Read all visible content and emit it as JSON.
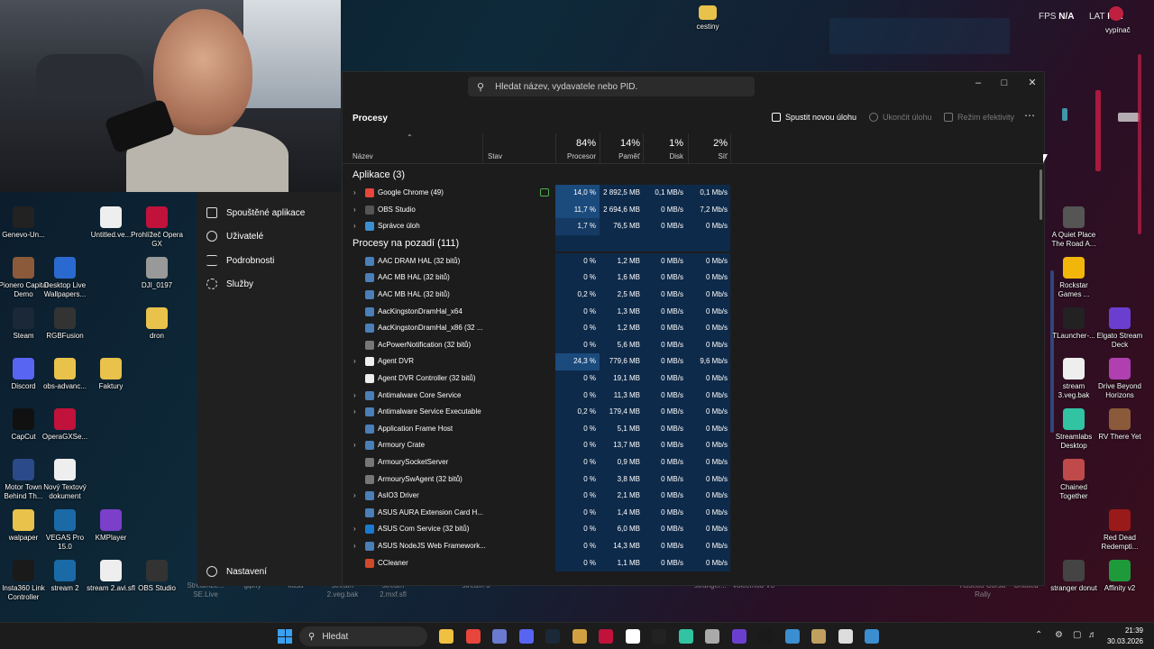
{
  "overlay": {
    "fps_label": "FPS",
    "fps_value": "N/A",
    "lat_label": "LAT",
    "lat_value": "N/A",
    "vypinac": "vypínač"
  },
  "desktop": {
    "top_folder": "cestiny",
    "left_icons": [
      {
        "label": "Genevo-Un...",
        "color": "#222"
      },
      {
        "label": "Untitled.ve...",
        "color": "#eee"
      },
      {
        "label": "Prohlížeč Opera GX",
        "color": "#c0123b"
      },
      {
        "label": "Pionero Capital Demo",
        "color": "#8a5a3a"
      },
      {
        "label": "Desktop Live Wallpapers...",
        "color": "#2a6ad0"
      },
      {
        "label": "DJI_0197",
        "color": "#999"
      },
      {
        "label": "Steam",
        "color": "#1b2838"
      },
      {
        "label": "RGBFusion",
        "color": "#333"
      },
      {
        "label": "dron",
        "color": "#e8c24a"
      },
      {
        "label": "Discord",
        "color": "#5865f2"
      },
      {
        "label": "obs-advanc...",
        "color": "#e8c24a"
      },
      {
        "label": "Faktury",
        "color": "#e8c24a"
      },
      {
        "label": "CapCut",
        "color": "#111"
      },
      {
        "label": "OperaGXSe...",
        "color": "#c0123b"
      },
      {
        "label": "Motor Town Behind Th...",
        "color": "#2a4a8a"
      },
      {
        "label": "Nový Textový dokument",
        "color": "#eee"
      },
      {
        "label": "walpaper",
        "color": "#e8c24a"
      },
      {
        "label": "VEGAS Pro 15.0",
        "color": "#1a6aa8"
      },
      {
        "label": "KMPlayer",
        "color": "#7b3fc9"
      },
      {
        "label": "Insta360 Link Controller",
        "color": "#1a1a1a"
      },
      {
        "label": "stream 2",
        "color": "#1a6aa8"
      },
      {
        "label": "stream 2.avi.sfl",
        "color": "#eee"
      },
      {
        "label": "OBS Studio",
        "color": "#333"
      }
    ],
    "bottom_faded": [
      "StreamLe... SE.Live",
      "giphy",
      "kasa",
      "stream 2.veg.bak",
      "stream 2.mxf.sfl",
      "stream 3",
      "stranger...",
      "voicemod V3",
      "Assetto Corsa Rally",
      "Untitled"
    ],
    "right_icons": [
      {
        "label": "A Quiet Place The Road A...",
        "color": "#555"
      },
      {
        "label": "Rockstar Games ...",
        "color": "#f2b50a"
      },
      {
        "label": "TLauncher-...",
        "color": "#222"
      },
      {
        "label": "Elgato Stream Deck",
        "color": "#6a3fd0"
      },
      {
        "label": "stream 3.veg.bak",
        "color": "#eee"
      },
      {
        "label": "Drive Beyond Horizons",
        "color": "#b03fb0"
      },
      {
        "label": "Streamlabs Desktop",
        "color": "#31c3a2"
      },
      {
        "label": "RV There Yet",
        "color": "#8a5a3a"
      },
      {
        "label": "Chained Together",
        "color": "#c04a4a"
      },
      {
        "label": "Red Dead Redempti...",
        "color": "#9a1a1a"
      },
      {
        "label": "stranger donut",
        "color": "#444"
      },
      {
        "label": "Affinity v2",
        "color": "#1f9a3a"
      }
    ]
  },
  "sidebar": {
    "items": [
      {
        "label": "Spouštěné aplikace"
      },
      {
        "label": "Uživatelé"
      },
      {
        "label": "Podrobnosti"
      },
      {
        "label": "Služby"
      }
    ],
    "settings": "Nastavení"
  },
  "taskmgr": {
    "search_placeholder": "Hledat název, vydavatele nebo PID.",
    "page_title": "Procesy",
    "run_task": "Spustit novou úlohu",
    "end_task": "Ukončit úlohu",
    "efficiency": "Režim efektivity",
    "columns": {
      "name": "Název",
      "status": "Stav",
      "cpu_pct": "84%",
      "cpu": "Procesor",
      "mem_pct": "14%",
      "mem": "Paměť",
      "disk_pct": "1%",
      "disk": "Disk",
      "net_pct": "2%",
      "net": "Síť"
    },
    "group_apps": "Aplikace (3)",
    "group_bg": "Procesy na pozadí (111)",
    "apps": [
      {
        "name": "Google Chrome (49)",
        "cpu": "14,0 %",
        "mem": "2 892,5 MB",
        "disk": "0,1 MB/s",
        "net": "0,1 Mb/s",
        "icon": "#e8453c",
        "exp": true,
        "leaf": true
      },
      {
        "name": "OBS Studio",
        "cpu": "11,7 %",
        "mem": "2 694,6 MB",
        "disk": "0 MB/s",
        "net": "7,2 Mb/s",
        "icon": "#555",
        "exp": true
      },
      {
        "name": "Správce úloh",
        "cpu": "1,7 %",
        "mem": "76,5 MB",
        "disk": "0 MB/s",
        "net": "0 Mb/s",
        "icon": "#3b8ed0",
        "exp": true
      }
    ],
    "bg": [
      {
        "name": "AAC DRAM HAL (32 bitů)",
        "cpu": "0 %",
        "mem": "1,2 MB",
        "disk": "0 MB/s",
        "net": "0 Mb/s",
        "icon": "#4a7fb8"
      },
      {
        "name": "AAC MB HAL (32 bitů)",
        "cpu": "0 %",
        "mem": "1,6 MB",
        "disk": "0 MB/s",
        "net": "0 Mb/s",
        "icon": "#4a7fb8"
      },
      {
        "name": "AAC MB HAL (32 bitů)",
        "cpu": "0,2 %",
        "mem": "2,5 MB",
        "disk": "0 MB/s",
        "net": "0 Mb/s",
        "icon": "#4a7fb8"
      },
      {
        "name": "AacKingstonDramHal_x64",
        "cpu": "0 %",
        "mem": "1,3 MB",
        "disk": "0 MB/s",
        "net": "0 Mb/s",
        "icon": "#4a7fb8"
      },
      {
        "name": "AacKingstonDramHal_x86 (32 ...",
        "cpu": "0 %",
        "mem": "1,2 MB",
        "disk": "0 MB/s",
        "net": "0 Mb/s",
        "icon": "#4a7fb8"
      },
      {
        "name": "AcPowerNotification (32 bitů)",
        "cpu": "0 %",
        "mem": "5,6 MB",
        "disk": "0 MB/s",
        "net": "0 Mb/s",
        "icon": "#777"
      },
      {
        "name": "Agent DVR",
        "cpu": "24,3 %",
        "mem": "779,6 MB",
        "disk": "0 MB/s",
        "net": "9,6 Mb/s",
        "icon": "#eee",
        "exp": true
      },
      {
        "name": "Agent DVR Controller (32 bitů)",
        "cpu": "0 %",
        "mem": "19,1 MB",
        "disk": "0 MB/s",
        "net": "0 Mb/s",
        "icon": "#eee"
      },
      {
        "name": "Antimalware Core Service",
        "cpu": "0 %",
        "mem": "11,3 MB",
        "disk": "0 MB/s",
        "net": "0 Mb/s",
        "icon": "#4a7fb8",
        "exp": true
      },
      {
        "name": "Antimalware Service Executable",
        "cpu": "0,2 %",
        "mem": "179,4 MB",
        "disk": "0 MB/s",
        "net": "0 Mb/s",
        "icon": "#4a7fb8",
        "exp": true
      },
      {
        "name": "Application Frame Host",
        "cpu": "0 %",
        "mem": "5,1 MB",
        "disk": "0 MB/s",
        "net": "0 Mb/s",
        "icon": "#4a7fb8"
      },
      {
        "name": "Armoury Crate",
        "cpu": "0 %",
        "mem": "13,7 MB",
        "disk": "0 MB/s",
        "net": "0 Mb/s",
        "icon": "#4a7fb8",
        "exp": true
      },
      {
        "name": "ArmourySocketServer",
        "cpu": "0 %",
        "mem": "0,9 MB",
        "disk": "0 MB/s",
        "net": "0 Mb/s",
        "icon": "#777"
      },
      {
        "name": "ArmourySwAgent (32 bitů)",
        "cpu": "0 %",
        "mem": "3,8 MB",
        "disk": "0 MB/s",
        "net": "0 Mb/s",
        "icon": "#777"
      },
      {
        "name": "AsIO3 Driver",
        "cpu": "0 %",
        "mem": "2,1 MB",
        "disk": "0 MB/s",
        "net": "0 Mb/s",
        "icon": "#4a7fb8",
        "exp": true
      },
      {
        "name": "ASUS AURA Extension Card H...",
        "cpu": "0 %",
        "mem": "1,4 MB",
        "disk": "0 MB/s",
        "net": "0 Mb/s",
        "icon": "#4a7fb8"
      },
      {
        "name": "ASUS Com Service (32 bitů)",
        "cpu": "0 %",
        "mem": "6,0 MB",
        "disk": "0 MB/s",
        "net": "0 Mb/s",
        "icon": "#1a7ad0",
        "exp": true
      },
      {
        "name": "ASUS NodeJS Web Framework...",
        "cpu": "0 %",
        "mem": "14,3 MB",
        "disk": "0 MB/s",
        "net": "0 Mb/s",
        "icon": "#4a7fb8",
        "exp": true
      },
      {
        "name": "CCleaner",
        "cpu": "0 %",
        "mem": "1,1 MB",
        "disk": "0 MB/s",
        "net": "0 Mb/s",
        "icon": "#d04a2a"
      }
    ]
  },
  "taskbar": {
    "search": "Hledat",
    "time": "21:39",
    "date": "30.03.2026",
    "icons": [
      "#f0c040",
      "#e8453c",
      "#6a7ad0",
      "#5865f2",
      "#1b2838",
      "#d0a040",
      "#c0123b",
      "#ffffff",
      "#222222",
      "#31c3a2",
      "#aaaaaa",
      "#6a3fd0",
      "#1a1a1a",
      "#3b8ed0",
      "#c0a060",
      "#dddddd",
      "#3b8ed0"
    ]
  },
  "colors": {
    "accent_blue": "#1b4a7d",
    "heat_low": "#0e2a4a",
    "window_bg": "#1c1c1c"
  }
}
